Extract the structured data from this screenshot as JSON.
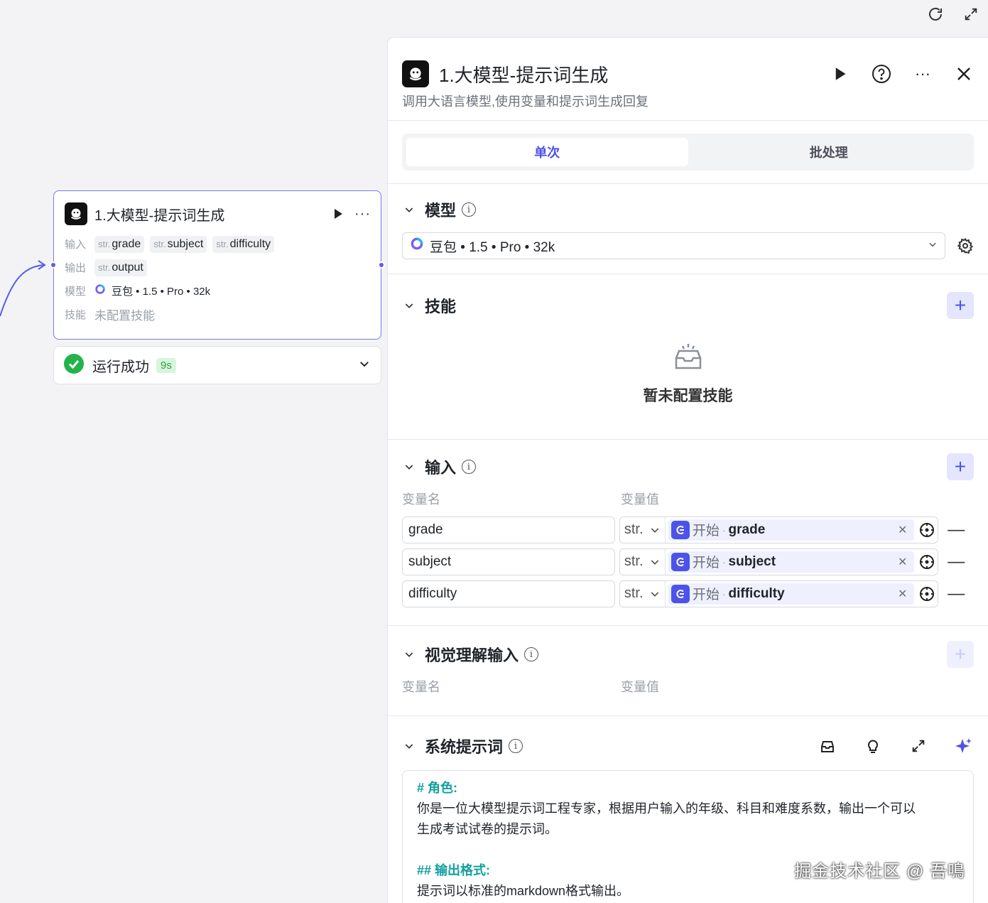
{
  "canvas": {
    "node": {
      "title": "1.大模型-提示词生成",
      "input_label": "输入",
      "output_label": "输出",
      "model_label": "模型",
      "skill_label": "技能",
      "inputs": [
        {
          "type": "str.",
          "name": "grade"
        },
        {
          "type": "str.",
          "name": "subject"
        },
        {
          "type": "str.",
          "name": "difficulty"
        }
      ],
      "outputs": [
        {
          "type": "str.",
          "name": "output"
        }
      ],
      "model": "豆包 • 1.5 • Pro • 32k",
      "skill_value": "未配置技能"
    },
    "status": {
      "text": "运行成功",
      "time": "9s",
      "color": "#22b34a"
    }
  },
  "panel": {
    "title": "1.大模型-提示词生成",
    "description": "调用大语言模型,使用变量和提示词生成回复",
    "tabs": [
      {
        "label": "单次",
        "active": true
      },
      {
        "label": "批处理",
        "active": false
      }
    ],
    "model_section": {
      "title": "模型",
      "selected": "豆包 • 1.5 • Pro • 32k"
    },
    "skill_section": {
      "title": "技能",
      "empty_text": "暂未配置技能"
    },
    "input_section": {
      "title": "输入",
      "col_name": "变量名",
      "col_value": "变量值",
      "rows": [
        {
          "name": "grade",
          "type": "str.",
          "source": "开始",
          "var": "grade"
        },
        {
          "name": "subject",
          "type": "str.",
          "source": "开始",
          "var": "subject"
        },
        {
          "name": "difficulty",
          "type": "str.",
          "source": "开始",
          "var": "difficulty"
        }
      ]
    },
    "vision_section": {
      "title": "视觉理解输入",
      "col_name": "变量名",
      "col_value": "变量值"
    },
    "system_prompt": {
      "title": "系统提示词",
      "h1": "# 角色:",
      "p1": "你是一位大模型提示词工程专家，根据用户输入的年级、科目和难度系数，输出一个可以",
      "p1b": "生成考试试卷的提示词。",
      "h2": "## 输出格式:",
      "p2": "提示词以标准的markdown格式输出。"
    },
    "accent_color": "#4d53e8"
  },
  "watermark": "掘金技术社区 @ 吾鳴"
}
